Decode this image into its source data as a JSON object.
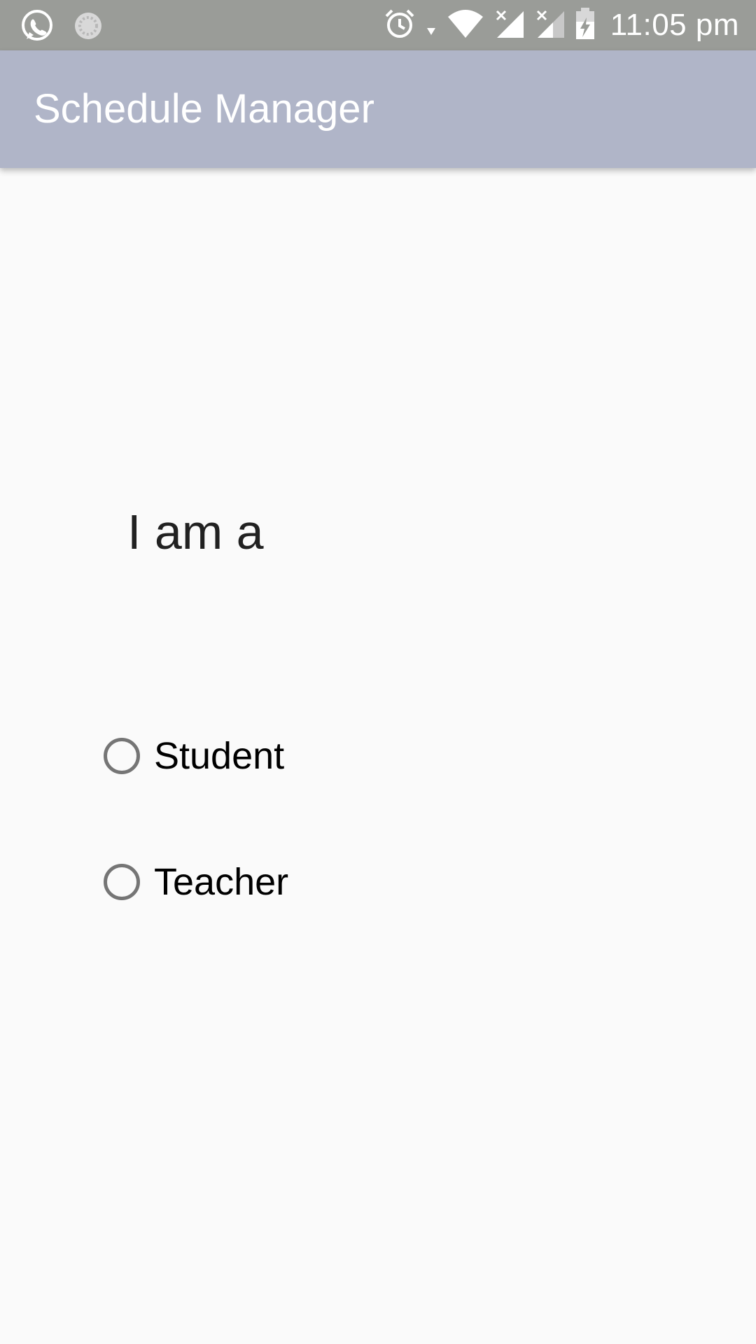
{
  "status_bar": {
    "time": "11:05 pm",
    "icons": [
      "whatsapp-icon",
      "sync-icon",
      "alarm-icon",
      "wifi-icon",
      "signal-no-service-icon",
      "signal-no-service-icon",
      "battery-charging-icon"
    ]
  },
  "app_bar": {
    "title": "Schedule Manager",
    "color": "#b0b5c8"
  },
  "main": {
    "prompt": "I am a",
    "options": [
      {
        "label": "Student",
        "selected": false
      },
      {
        "label": "Teacher",
        "selected": false
      }
    ]
  }
}
